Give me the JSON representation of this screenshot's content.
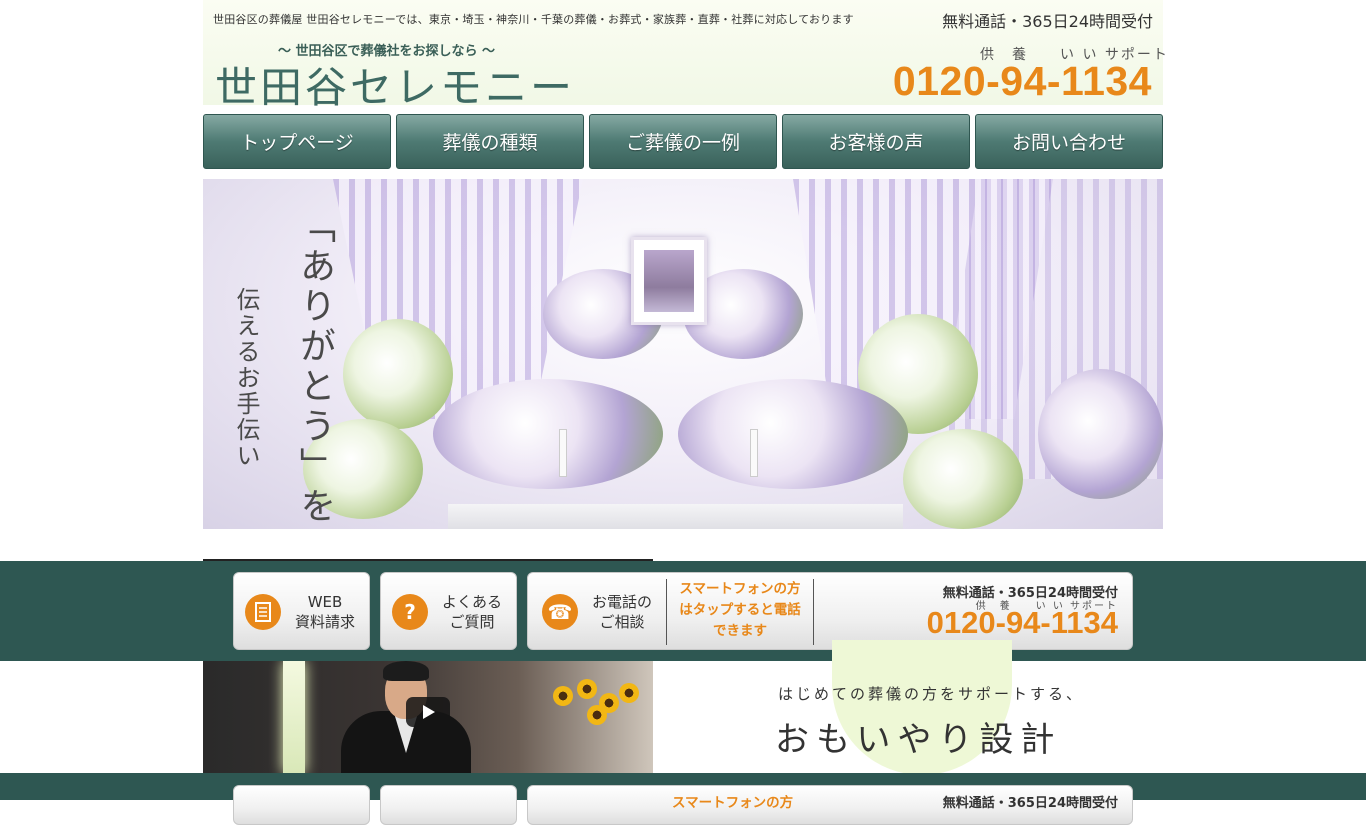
{
  "header": {
    "tagline": "世田谷区の葬儀屋 世田谷セレモニーでは、東京・埼玉・神奈川・千葉の葬儀・お葬式・家族葬・直葬・社葬に対応しております",
    "hours": "無料通話・365日24時間受付",
    "subcatch": "〜 世田谷区で葬儀社をお探しなら 〜",
    "logo": "世田谷セレモニー",
    "phone_reading": "供　養　　い い サポート",
    "phone": "0120-94-1134"
  },
  "nav": {
    "items": [
      {
        "label": "トップページ"
      },
      {
        "label": "葬儀の種類"
      },
      {
        "label": "ご葬儀の一例"
      },
      {
        "label": "お客様の声"
      },
      {
        "label": "お問い合わせ"
      }
    ]
  },
  "hero": {
    "vertical_main": "「ありがとう」を",
    "vertical_sub": "伝えるお手伝い"
  },
  "contact_bar": {
    "web": {
      "line1": "WEB",
      "line2": "資料請求"
    },
    "faq": {
      "line1": "よくある",
      "line2": "ご質問"
    },
    "phone_consult": {
      "line1": "お電話の",
      "line2": "ご相談"
    },
    "smartphone_note": {
      "line1": "スマートフォンの方",
      "line2": "はタップすると電話",
      "line3": "できます"
    },
    "hours": "無料通話・365日24時間受付",
    "phone_reading": "供　養　　い い サポート",
    "phone": "0120-94-1134"
  },
  "catch": {
    "sub": "はじめての葬儀の方をサポートする、",
    "main": "おもいやり設計"
  },
  "colors": {
    "accent_orange": "#e8881a",
    "brand_green": "#3e6a63",
    "band_green": "#2e5752"
  },
  "icons": {
    "web": "document-icon",
    "faq": "question-icon",
    "phone": "telephone-icon",
    "video": "play-icon"
  }
}
